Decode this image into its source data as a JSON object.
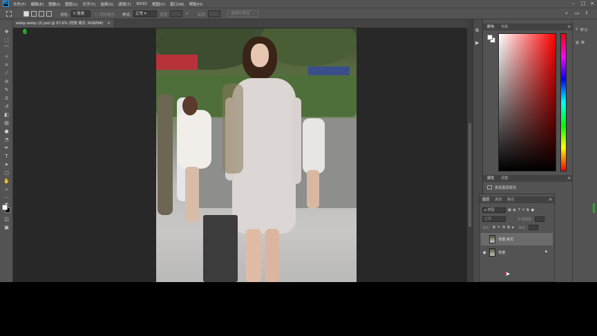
{
  "menu": {
    "items": [
      "文件(F)",
      "编辑(E)",
      "图像(I)",
      "图层(L)",
      "文字(Y)",
      "选择(S)",
      "滤镜(T)",
      "3D(D)",
      "视图(V)",
      "窗口(W)",
      "帮助(H)"
    ]
  },
  "options_bar": {
    "feather_label": "羽化:",
    "feather_value": "0 像素",
    "antialias_label": "消除锯齿",
    "style_label": "样式:",
    "style_value": "正常",
    "width_label": "宽度:",
    "height_label": "高度:",
    "select_mask_button": "选择并遮住 ..."
  },
  "document": {
    "tab_title": "webp.webp (2).psd @ 97.6% (背景 拷贝, RGB/8#)",
    "tab_close": "×",
    "overlay_number": "6"
  },
  "color_panel": {
    "tabs": [
      "颜色",
      "色板"
    ]
  },
  "properties_panel": {
    "tabs": [
      "属性",
      "调整"
    ],
    "title": "像素图层属性"
  },
  "layers_panel": {
    "tabs": [
      "图层",
      "通道",
      "路径"
    ],
    "filter_value": "ρ 类型",
    "blend_mode": "正常",
    "opacity_label": "不透明度:",
    "lock_label": "锁定:",
    "fill_label": "填充:",
    "layers": [
      {
        "name": "背景 拷贝",
        "selected": true,
        "visible": false,
        "locked": false
      },
      {
        "name": "背景",
        "selected": false,
        "visible": true,
        "locked": true
      }
    ]
  },
  "side_panel": {
    "learn_label": "学习",
    "library_label": "库"
  },
  "colors": {
    "ui_bg": "#535353",
    "canvas_bg": "#282828",
    "overlay_number": "#1fff1f",
    "accent_red": "#e02020"
  }
}
